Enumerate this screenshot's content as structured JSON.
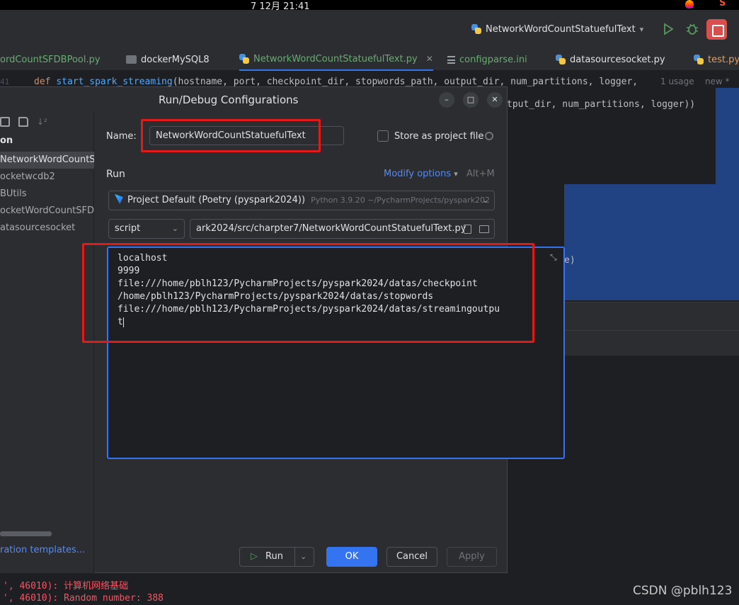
{
  "os": {
    "clock": "7 12月  21:41"
  },
  "toolbar": {
    "run_config": "NetworkWordCountStatuefulText"
  },
  "tabs": [
    {
      "label": "ordCountSFDBPool.py"
    },
    {
      "label": "dockerMySQL8"
    },
    {
      "label": "NetworkWordCountStatuefulText.py"
    },
    {
      "label": "configparse.ini"
    },
    {
      "label": "datasourcesocket.py"
    },
    {
      "label": "test.py"
    }
  ],
  "editor": {
    "line_num": "41",
    "kw_def": "def",
    "fn_name": "start_spark_streaming",
    "signature": "(hostname, port, checkpoint_dir, stopwords_path, output_dir, num_partitions, logger,",
    "usage": "1 usage",
    "new_mark": "new *",
    "continuation": "tput_dir, num_partitions, logger))",
    "continuation2": "e)"
  },
  "dialog": {
    "title": "Run/Debug Configurations",
    "left_header": "on",
    "left_items": [
      "NetworkWordCountSta",
      "ocketwcdb2",
      "BUtils",
      "ocketWordCountSFDB",
      "atasourcesocket"
    ],
    "templates_link": "ration templates...",
    "name_label": "Name:",
    "name_value": "NetworkWordCountStatuefulText",
    "store_label": "Store as project file",
    "run_section": "Run",
    "modify_options": "Modify options",
    "modify_shortcut": "Alt+M",
    "interpreter": "Project Default (Poetry (pyspark2024))",
    "interpreter_detail": "Python 3.9.20 ~/PycharmProjects/pyspark202",
    "script_type": "script",
    "script_path": "ark2024/src/charpter7/NetworkWordCountStatuefulText.py",
    "params_text": "localhost\n9999\nfile:///home/pblh123/PycharmProjects/pyspark2024/datas/checkpoint\n/home/pblh123/PycharmProjects/pyspark2024/datas/stopwords\nfile:///home/pblh123/PycharmProjects/pyspark2024/datas/streamingoutpu\nt",
    "buttons": {
      "run": "Run",
      "ok": "OK",
      "cancel": "Cancel",
      "apply": "Apply"
    }
  },
  "console": {
    "line1": "', 46010): 计算机网络基础",
    "line2": "', 46010): Random number: 388"
  },
  "watermark": "CSDN @pblh123"
}
